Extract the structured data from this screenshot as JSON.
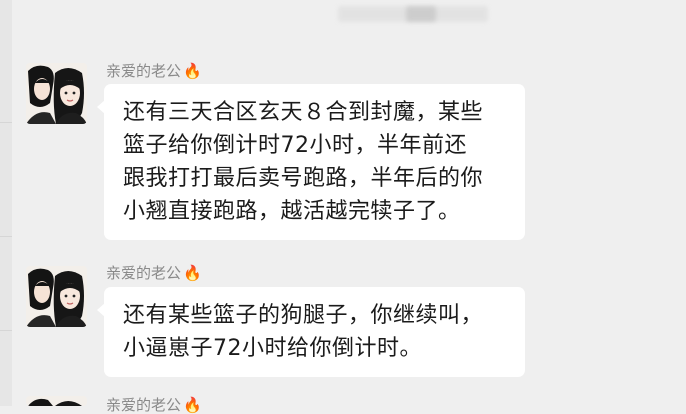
{
  "chat": {
    "sender_name": "亲爱的老公",
    "fire_emoji": "🔥",
    "messages": [
      {
        "text": "还有三天合区玄天８合到封魔，某些\n篮子给你倒计时72小时，半年前还\n跟我打打最后卖号跑路，半年后的你\n小翘直接跑路，越活越完犊子了。"
      },
      {
        "text": "还有某些篮子的狗腿子，你继续叫，\n小逼崽子72小时给你倒计时。"
      }
    ]
  },
  "colors": {
    "background": "#efefef",
    "bubble": "#ffffff",
    "name": "#8a8a8a",
    "text": "#1b1b1b"
  }
}
